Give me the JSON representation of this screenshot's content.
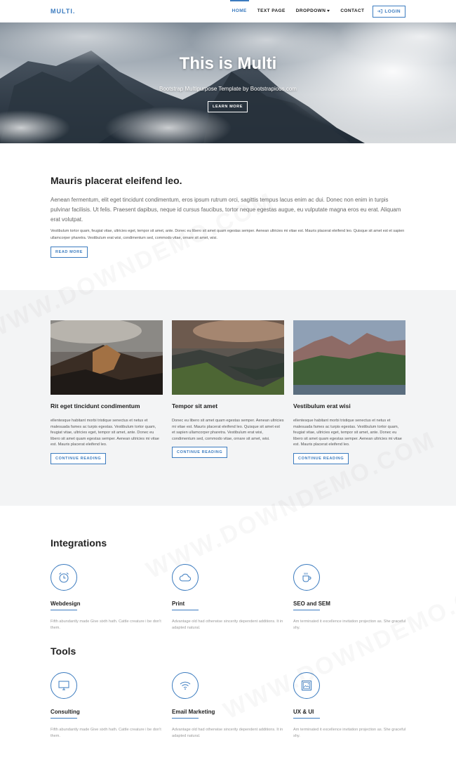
{
  "nav": {
    "brand": "MULTI.",
    "items": [
      {
        "label": "HOME",
        "active": true
      },
      {
        "label": "TEXT PAGE"
      },
      {
        "label": "DROPDOWN"
      },
      {
        "label": "CONTACT"
      }
    ],
    "login_label": "LOGIN"
  },
  "hero": {
    "title": "This is Multi",
    "subtitle": "Bootstrap Multipurpose Template by Bootstrapious.com",
    "button": "LEARN MORE"
  },
  "intro": {
    "heading": "Mauris placerat eleifend leo.",
    "lead": "Aenean fermentum, elit eget tincidunt condimentum, eros ipsum rutrum orci, sagittis tempus lacus enim ac dui. Donec non enim in turpis pulvinar facilisis. Ut felis. Praesent dapibus, neque id cursus faucibus, tortor neque egestas augue, eu vulputate magna eros eu erat. Aliquam erat volutpat.",
    "body": "Vestibulum tortor quam, feugiat vitae, ultricies eget, tempor sit amet, ante. Donec eu libero sit amet quam egestas semper. Aenean ultricies mi vitae est. Mauris placerat eleifend leo. Quisque sit amet est et sapien ullamcorper pharetra. Vestibulum erat wisi, condimentum sed, commodo vitae, ornare sit amet, wisi.",
    "button": "READ MORE"
  },
  "cards": [
    {
      "title": "Rit eget tincidunt condimentum",
      "text": "ellentesque habitant morbi tristique senectus et netus et malesuada fames ac turpis egestas. Vestibulum tortor quam, feugiat vitae, ultricies eget, tempor sit amet, ante. Donec eu libero sit amet quam egestas semper. Aenean ultricies mi vitae est. Mauris placerat eleifend leo.",
      "button": "CONTINUE READING"
    },
    {
      "title": "Tempor sit amet",
      "text": "Donec eu libero sit amet quam egestas semper. Aenean ultricies mi vitae est. Mauris placerat eleifend leo. Quisque sit amet est et sapien ullamcorper pharetra. Vestibulum erat wisi, condimentum sed, commodo vitae, ornare sit amet, wisi.",
      "button": "CONTINUE READING"
    },
    {
      "title": "Vestibulum erat wisi",
      "text": "ellentesque habitant morbi tristique senectus et netus et malesuada fames ac turpis egestas. Vestibulum tortor quam, feugiat vitae, ultricies eget, tempor sit amet, ante. Donec eu libero sit amet quam egestas semper. Aenean ultricies mi vitae est. Mauris placerat eleifend leo.",
      "button": "CONTINUE READING"
    }
  ],
  "integrations": {
    "title": "Integrations",
    "items": [
      {
        "icon": "alarm-clock-icon",
        "title": "Webdesign",
        "text": "Fifth abundantly made Give sixth hath. Cattle creature i be don't them."
      },
      {
        "icon": "cloud-icon",
        "title": "Print",
        "text": "Advantage old had otherwise sincerity dependent additions. It in adapted natural."
      },
      {
        "icon": "coffee-cup-icon",
        "title": "SEO and SEM",
        "text": "Am terminated it excellence invitation projection as. She graceful shy."
      }
    ]
  },
  "tools": {
    "title": "Tools",
    "items": [
      {
        "icon": "monitor-icon",
        "title": "Consulting",
        "text": "Fifth abundantly made Give sixth hath. Cattle creature i be don't them."
      },
      {
        "icon": "wifi-icon",
        "title": "Email Marketing",
        "text": "Advantage old had otherwise sincerity dependent additions. It in adapted natural."
      },
      {
        "icon": "image-frame-icon",
        "title": "UX & UI",
        "text": "Am terminated it excellence invitation projection as. She graceful shy."
      }
    ]
  },
  "watermark": "WWW.DOWNDEMO.COM",
  "colors": {
    "accent": "#3b7bbf",
    "section_bg": "#f3f4f5"
  }
}
